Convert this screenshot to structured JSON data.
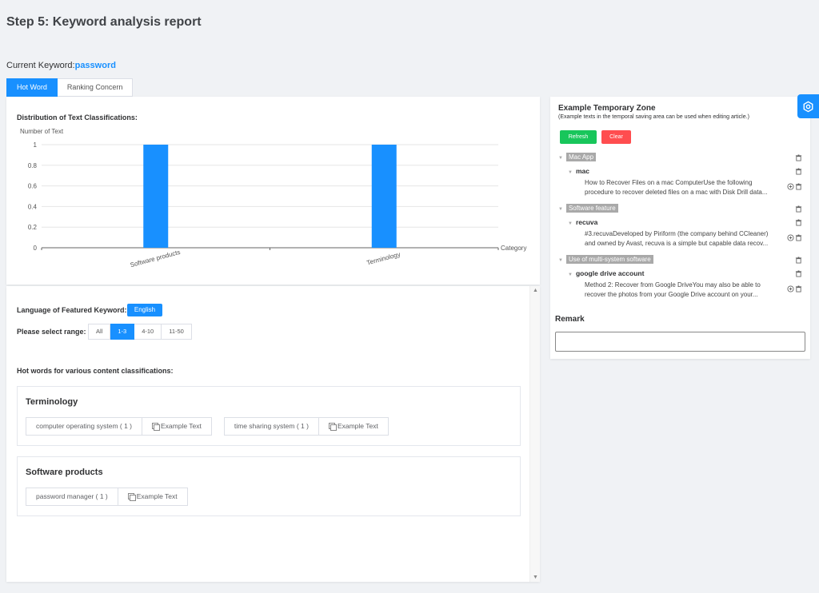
{
  "page_title": "Step 5: Keyword analysis report",
  "current_keyword": {
    "label": "Current Keyword:",
    "value": "password"
  },
  "tabs": [
    {
      "label": "Hot Word",
      "active": true
    },
    {
      "label": "Ranking Concern",
      "active": false
    }
  ],
  "chart_title": "Distribution of Text Classifications:",
  "chart_data": {
    "type": "bar",
    "title": "",
    "ylabel": "Number of Text",
    "xlabel": "Category",
    "categories": [
      "Software products",
      "Terminology"
    ],
    "values": [
      1,
      1
    ],
    "ylim": [
      0,
      1
    ],
    "yticks": [
      "1",
      "0.8",
      "0.6",
      "0.4",
      "0.2",
      "0"
    ],
    "bar_color": "#1890ff",
    "grid": true
  },
  "language": {
    "label": "Language of Featured Keyword:",
    "value": "English"
  },
  "range": {
    "label": "Please select range:",
    "options": [
      "All",
      "1-3",
      "4-10",
      "11-50"
    ],
    "selected": "1-3"
  },
  "hotwords_heading": "Hot words for various content classifications:",
  "categories": [
    {
      "title": "Terminology",
      "tags": [
        {
          "word": "computer operating system ( 1 )",
          "action": "Example Text"
        },
        {
          "word": "time sharing system ( 1 )",
          "action": "Example Text"
        }
      ]
    },
    {
      "title": "Software products",
      "tags": [
        {
          "word": "password manager ( 1 )",
          "action": "Example Text"
        }
      ]
    }
  ],
  "side": {
    "title": "Example Temporary Zone",
    "subtitle": "(Example texts in the temporal saving area can be used when editing article.)",
    "refresh_label": "Refresh",
    "clear_label": "Clear",
    "tree": [
      {
        "category": "Mac App",
        "sub": "mac",
        "line1": "How to Recover Files on a mac ComputerUse the following",
        "line2": "procedure to recover deleted files on a mac with Disk Drill data..."
      },
      {
        "category": "Software feature",
        "sub": "recuva",
        "line1": "#3.recuvaDeveloped by Piriform (the company behind CCleaner)",
        "line2": "and owned by Avast, recuva is a simple but capable data recov..."
      },
      {
        "category": "Use of multi-system software",
        "sub": "google drive account",
        "line1": "Method 2: Recover from Google DriveYou may also be able to",
        "line2": "recover the photos from your Google Drive account on your..."
      }
    ],
    "remark_label": "Remark",
    "remark_value": ""
  },
  "colors": {
    "accent": "#1890ff",
    "refresh": "#18c65b",
    "clear": "#ff4d4f",
    "tree_label_bg": "#a9a9a9"
  }
}
